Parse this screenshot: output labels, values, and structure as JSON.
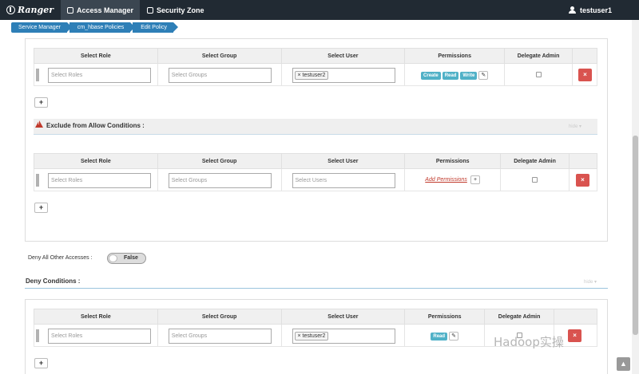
{
  "header": {
    "brand": "Ranger",
    "nav": [
      {
        "label": "Access Manager"
      },
      {
        "label": "Security Zone"
      }
    ],
    "user": "testuser1"
  },
  "breadcrumb": [
    "Service Manager",
    "cm_hbase Policies",
    "Edit Policy"
  ],
  "columns": {
    "role": "Select Role",
    "group": "Select Group",
    "user": "Select User",
    "permissions": "Permissions",
    "delegate": "Delegate Admin"
  },
  "placeholders": {
    "roles": "Select Roles",
    "groups": "Select Groups",
    "users": "Select Users"
  },
  "allow": {
    "user_tag": "testuser2",
    "permissions": [
      "Create",
      "Read",
      "Write"
    ]
  },
  "exclude": {
    "title": "Exclude from Allow Conditions :",
    "hide": "hide",
    "add_permissions": "Add Permissions"
  },
  "deny_all": {
    "label": "Deny All Other Accesses :",
    "value": "False"
  },
  "deny": {
    "title": "Deny Conditions :",
    "hide": "hide",
    "user_tag": "testuser2",
    "permissions": [
      "Read"
    ]
  },
  "watermark": "Hadoop实操",
  "icons": {
    "plus": "+",
    "delete": "×",
    "edit": "✎",
    "top": "▲"
  }
}
